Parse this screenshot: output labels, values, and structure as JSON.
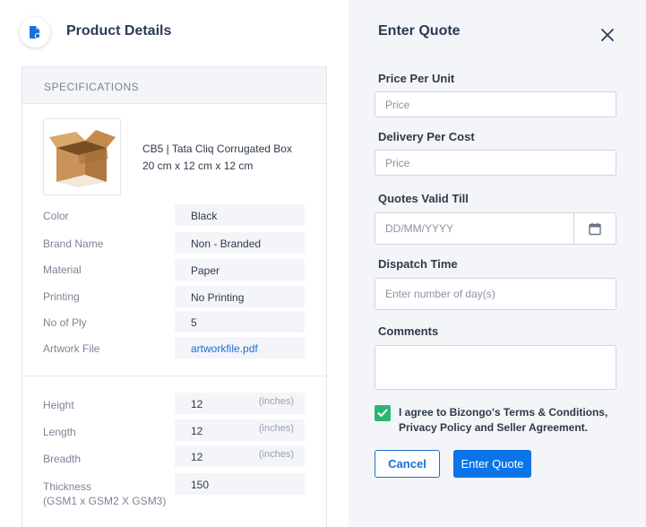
{
  "left_panel": {
    "title": "Product Details",
    "icon": "document-icon",
    "section_heading": "SPECIFICATIONS",
    "product": {
      "name_line1": "CB5 | Tata Cliq Corrugated Box",
      "name_line2": "20 cm x 12 cm x 12 cm",
      "image": "cardboard-box-image"
    },
    "specs": [
      {
        "label": "Color",
        "value": "Black"
      },
      {
        "label": "Brand Name",
        "value": "Non - Branded"
      },
      {
        "label": "Material",
        "value": "Paper"
      },
      {
        "label": "Printing",
        "value": "No Printing"
      },
      {
        "label": "No of Ply",
        "value": "5"
      },
      {
        "label": "Artwork File",
        "value": "artworkfile.pdf"
      }
    ],
    "dimensions": [
      {
        "label": "Height",
        "value": "12",
        "unit": "(inches)"
      },
      {
        "label": "Length",
        "value": "12",
        "unit": "(inches)"
      },
      {
        "label": "Breadth",
        "value": "12",
        "unit": "(inches)"
      }
    ],
    "thickness": {
      "label_line1": "Thickness",
      "label_line2": "(GSM1 x GSM2 X GSM3)",
      "value": "150"
    }
  },
  "quote_form": {
    "title": "Enter Quote",
    "close_icon": "close-icon",
    "price_per_unit": {
      "label": "Price Per Unit",
      "placeholder": "Price",
      "value": ""
    },
    "delivery_per_cost": {
      "label": "Delivery Per Cost",
      "placeholder": "Price",
      "value": ""
    },
    "quotes_valid_till": {
      "label": "Quotes Valid Till",
      "placeholder": "DD/MM/YYYY",
      "value": "",
      "icon": "calendar-icon"
    },
    "dispatch_time": {
      "label": "Dispatch Time",
      "placeholder": "Enter number of day(s)",
      "value": ""
    },
    "comments": {
      "label": "Comments",
      "placeholder": "",
      "value": ""
    },
    "agreement": {
      "checked": true,
      "line1": "I agree to Bizongo's Terms & Conditions,",
      "line2": "Privacy Policy and Seller Agreement."
    },
    "cancel_label": "Cancel",
    "submit_label": "Enter Quote"
  },
  "colors": {
    "primary": "#0a74e8",
    "check_green": "#2bb673",
    "link_blue": "#1a6fd6",
    "panel_gray": "#f4f5f8"
  }
}
